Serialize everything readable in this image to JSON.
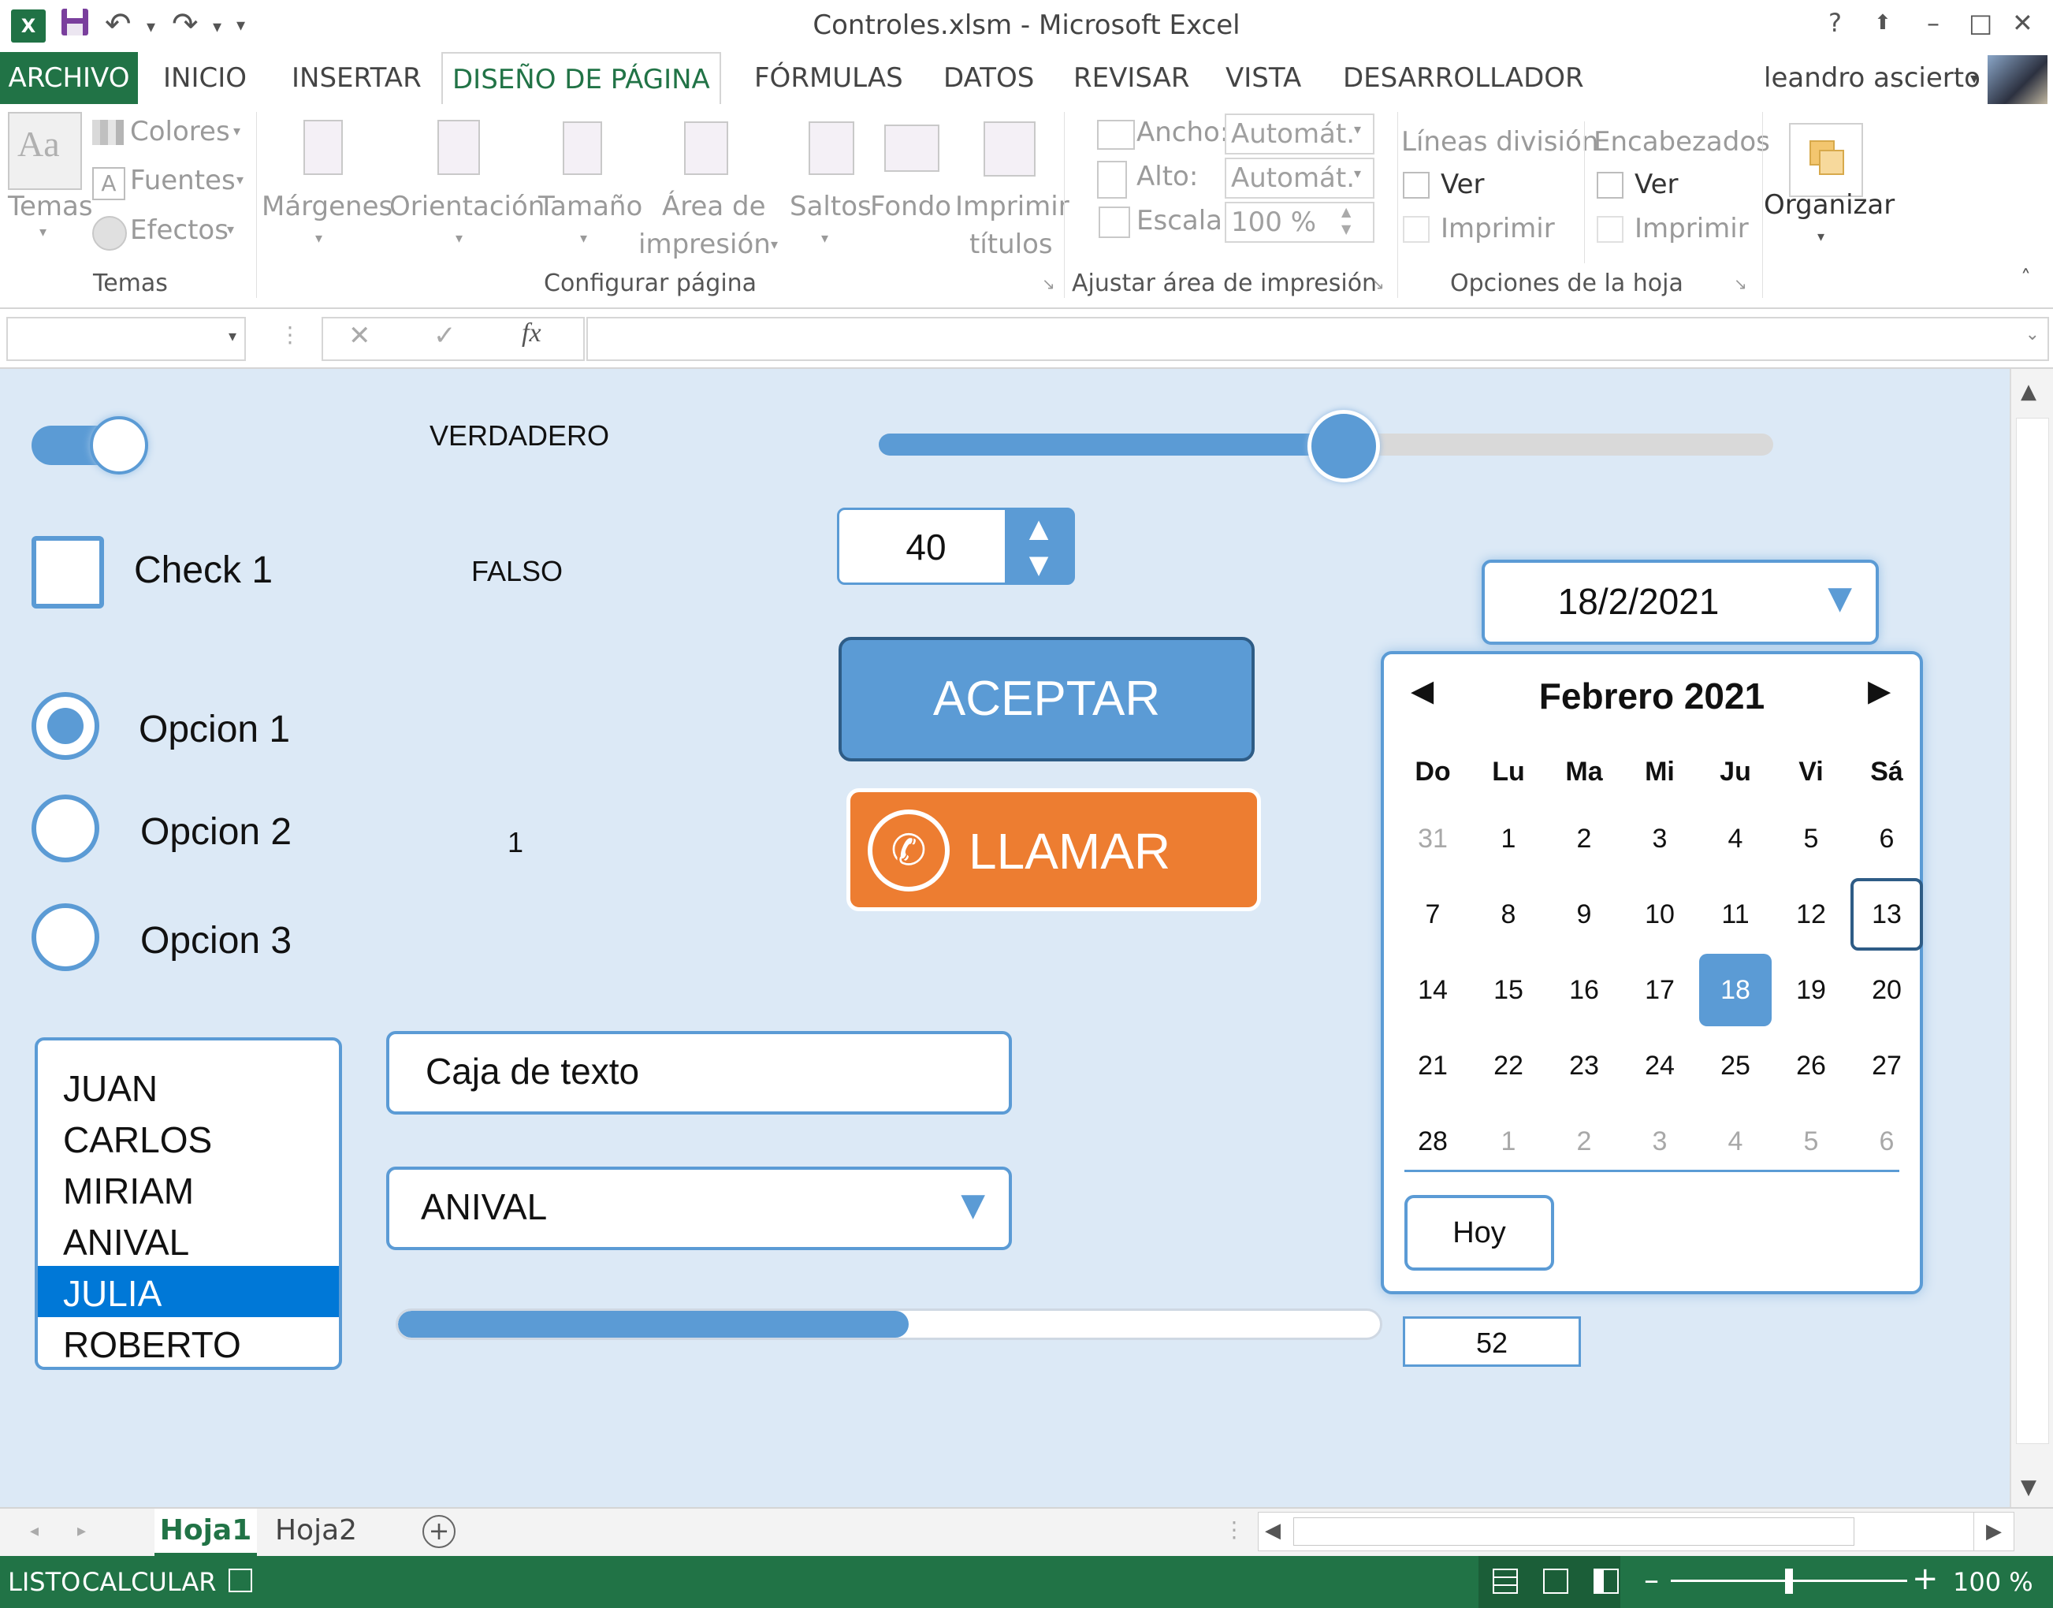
{
  "window": {
    "title": "Controles.xlsm - Microsoft Excel",
    "app_icon": "excel-icon"
  },
  "quick_access": {
    "save_icon": "save-icon",
    "undo_icon": "undo-icon",
    "redo_icon": "redo-icon"
  },
  "window_controls": {
    "help": "?",
    "restore_ribbon": "⬆",
    "minimize": "–",
    "maximize": "□",
    "close": "✕"
  },
  "tabs": [
    {
      "label": "ARCHIVO"
    },
    {
      "label": "INICIO"
    },
    {
      "label": "INSERTAR"
    },
    {
      "label": "DISEÑO DE PÁGINA"
    },
    {
      "label": "FÓRMULAS"
    },
    {
      "label": "DATOS"
    },
    {
      "label": "REVISAR"
    },
    {
      "label": "VISTA"
    },
    {
      "label": "DESARROLLADOR"
    }
  ],
  "user": {
    "name": "leandro ascierto"
  },
  "ribbon": {
    "temas": {
      "main": "Temas",
      "colores": "Colores",
      "fuentes": "Fuentes",
      "efectos": "Efectos",
      "group": "Temas"
    },
    "config": {
      "margenes": "Márgenes",
      "orientacion": "Orientación",
      "tamano": "Tamaño",
      "area1": "Área de",
      "area2": "impresión",
      "saltos": "Saltos",
      "fondo": "Fondo",
      "imprimir1": "Imprimir",
      "imprimir2": "títulos",
      "group": "Configurar página"
    },
    "ajustar": {
      "ancho": "Ancho:",
      "ancho_val": "Automát.",
      "alto": "Alto:",
      "alto_val": "Automát.",
      "escala": "Escala:",
      "escala_val": "100 %",
      "group": "Ajustar área de impresión"
    },
    "opciones": {
      "lineas": "Líneas división",
      "encabezados": "Encabezados",
      "ver": "Ver",
      "imprimir": "Imprimir",
      "group": "Opciones de la hoja"
    },
    "organizar": {
      "label": "Organizar"
    }
  },
  "formula_bar": {
    "name_box": "",
    "cancel": "✕",
    "enter": "✓",
    "fx": "fx",
    "formula": ""
  },
  "sheet": {
    "toggle": {
      "state": true,
      "value_label": "VERDADERO"
    },
    "slider": {
      "value_fraction": 0.52
    },
    "checkbox": {
      "label": "Check 1",
      "checked": false,
      "value_label": "FALSO"
    },
    "spinner": {
      "value": "40"
    },
    "radios": [
      {
        "label": "Opcion 1",
        "selected": true
      },
      {
        "label": "Opcion 2",
        "selected": false
      },
      {
        "label": "Opcion 3",
        "selected": false
      }
    ],
    "radio_value": "1",
    "accept_button": "ACEPTAR",
    "call_button": "LLAMAR",
    "listbox": {
      "items": [
        "JUAN",
        "CARLOS",
        "MIRIAM",
        "ANIVAL",
        "JULIA",
        "ROBERTO"
      ],
      "selected_index": 4
    },
    "textbox": {
      "value": "Caja de texto"
    },
    "combobox": {
      "value": "ANIVAL"
    },
    "progress": {
      "value_fraction": 0.52,
      "label": "52"
    },
    "datepicker": {
      "value": "18/2/2021",
      "month_label": "Febrero 2021",
      "weekdays": [
        "Do",
        "Lu",
        "Ma",
        "Mi",
        "Ju",
        "Vi",
        "Sá"
      ],
      "weeks": [
        [
          "31",
          "1",
          "2",
          "3",
          "4",
          "5",
          "6"
        ],
        [
          "7",
          "8",
          "9",
          "10",
          "11",
          "12",
          "13"
        ],
        [
          "14",
          "15",
          "16",
          "17",
          "18",
          "19",
          "20"
        ],
        [
          "21",
          "22",
          "23",
          "24",
          "25",
          "26",
          "27"
        ],
        [
          "28",
          "1",
          "2",
          "3",
          "4",
          "5",
          "6"
        ]
      ],
      "selected_day": "18",
      "today_day": "13",
      "today_button": "Hoy"
    }
  },
  "sheet_tabs": {
    "active": "Hoja1",
    "other": "Hoja2",
    "add": "+"
  },
  "status": {
    "ready": "LISTO",
    "calc": "CALCULAR",
    "zoom": "100 %",
    "zoom_fraction": 0.5
  },
  "colors": {
    "excel_green": "#217346",
    "accent_blue": "#5b9bd5",
    "orange": "#ed7d31",
    "sheet_bg": "#dce9f6"
  }
}
